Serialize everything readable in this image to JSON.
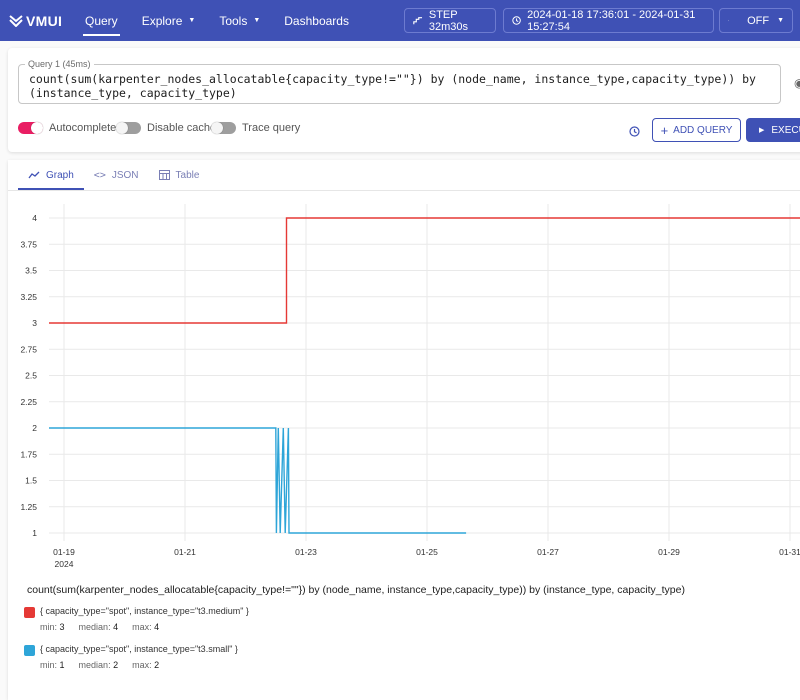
{
  "topbar": {
    "logo_text": "VMUI",
    "nav": [
      {
        "label": "Query",
        "active": true,
        "dropdown": false
      },
      {
        "label": "Explore",
        "active": false,
        "dropdown": true
      },
      {
        "label": "Tools",
        "active": false,
        "dropdown": true
      },
      {
        "label": "Dashboards",
        "active": false,
        "dropdown": false
      }
    ],
    "step_label": "STEP 32m30s",
    "time_range": "2024-01-18 17:36:01 - 2024-01-31 15:27:54",
    "refresh_label": "OFF"
  },
  "query": {
    "label": "Query 1 (45ms)",
    "expr": "count(sum(karpenter_nodes_allocatable{capacity_type!=\"\"}) by (node_name, instance_type,capacity_type)) by (instance_type, capacity_type)",
    "toggles": {
      "autocomplete": "Autocomplete",
      "disable_cache": "Disable cache",
      "trace_query": "Trace query"
    },
    "add_query_label": "ADD QUERY",
    "execute_label": "EXECU"
  },
  "tabs": [
    {
      "label": "Graph",
      "icon": "graph-icon",
      "active": true
    },
    {
      "label": "JSON",
      "icon": "code-icon",
      "active": false
    },
    {
      "label": "Table",
      "icon": "table-icon",
      "active": false
    }
  ],
  "colors": {
    "accent": "#3f51b5",
    "toggle_on": "#e91e63",
    "series_red": "#e53935",
    "series_blue": "#2ea5d8"
  },
  "chart_data": {
    "type": "line",
    "title": "count(sum(karpenter_nodes_allocatable{capacity_type!=\"\"}) by (node_name, instance_type,capacity_type)) by (instance_type, capacity_type)",
    "x_ticks": [
      "01-19",
      "01-21",
      "01-23",
      "01-25",
      "01-27",
      "01-29",
      "01-31"
    ],
    "x_tick_sublabel": "2024",
    "x_range": [
      "2024-01-18T17:36:01",
      "2024-01-31T15:27:54"
    ],
    "y_ticks": [
      "1",
      "1.25",
      "1.5",
      "1.75",
      "2",
      "2.25",
      "2.5",
      "2.75",
      "3",
      "3.25",
      "3.5",
      "3.75",
      "4"
    ],
    "ylim": [
      1,
      4
    ],
    "grid": true,
    "series": [
      {
        "name": "{ capacity_type=\"spot\", instance_type=\"t3.medium\" }",
        "color": "#e53935",
        "points": [
          [
            "2024-01-18T17:36",
            3
          ],
          [
            "2024-01-22T16:15",
            3
          ],
          [
            "2024-01-22T16:15",
            4
          ],
          [
            "2024-01-31T15:27",
            4
          ]
        ],
        "min": "3",
        "median": "4",
        "max": "4"
      },
      {
        "name": "{ capacity_type=\"spot\", instance_type=\"t3.small\" }",
        "color": "#2ea5d8",
        "points": [
          [
            "2024-01-18T17:36",
            2
          ],
          [
            "2024-01-22T12:00",
            2
          ],
          [
            "2024-01-22T12:15",
            1
          ],
          [
            "2024-01-22T13:00",
            2
          ],
          [
            "2024-01-22T13:45",
            1
          ],
          [
            "2024-01-22T15:00",
            2
          ],
          [
            "2024-01-22T15:45",
            1
          ],
          [
            "2024-01-22T17:00",
            2
          ],
          [
            "2024-01-22T17:15",
            1
          ],
          [
            "2024-01-25T15:30",
            1
          ]
        ],
        "min": "1",
        "median": "2",
        "max": "2"
      }
    ]
  },
  "legend": {
    "stat_labels": {
      "min": "min:",
      "median": "median:",
      "max": "max:"
    }
  }
}
